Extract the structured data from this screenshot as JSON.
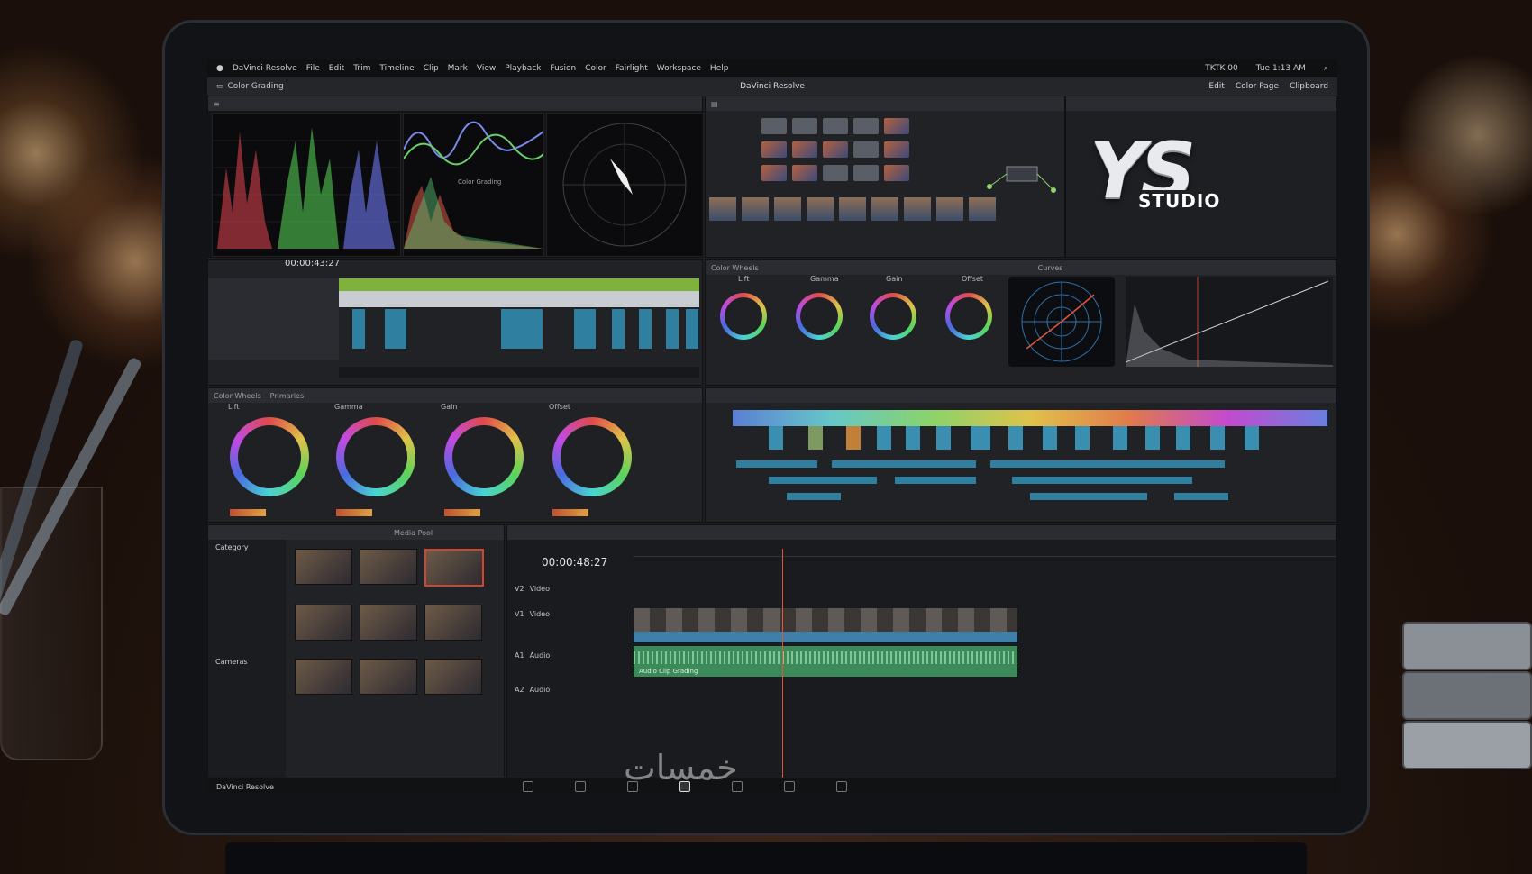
{
  "app": {
    "name": "DaVinci Resolve"
  },
  "menubar": {
    "apple": "",
    "app_title": "DaVinci Resolve",
    "items": [
      "File",
      "Edit",
      "Trim",
      "Timeline",
      "Clip",
      "Mark",
      "View",
      "Playback",
      "Fusion",
      "Color",
      "Fairlight",
      "Workspace",
      "Help"
    ],
    "right": [
      "TKTK 00",
      "Tue 1:13 AM"
    ]
  },
  "toolbar": {
    "color_grading": "Color Grading",
    "title": "DaVinci Resolve",
    "right": [
      "Edit",
      "Color Page",
      "Clipboard"
    ]
  },
  "scopes": {
    "wave_label": "Color Grading"
  },
  "timeline_top": {
    "timecode": "00:00:43:27"
  },
  "logo": {
    "ys": "YS",
    "studio": "STUDIO"
  },
  "color_panel": {
    "title": "Color Wheels",
    "curves": "Curves",
    "wheel_labels": [
      "Lift",
      "Gamma",
      "Gain",
      "Offset"
    ]
  },
  "wheels_panel": {
    "tabs": [
      "Color Wheels",
      "Primaries"
    ],
    "labels": [
      "Lift",
      "Gamma",
      "Gain",
      "Offset"
    ]
  },
  "media_pool": {
    "header": "Media Pool",
    "category": "Category",
    "cameras": "Cameras"
  },
  "timeline": {
    "timecode": "00:00:48:27",
    "tracks": [
      {
        "id": "V1",
        "name": "Video"
      },
      {
        "id": "V2",
        "name": "Video"
      },
      {
        "id": "A1",
        "name": "Audio"
      },
      {
        "id": "A2",
        "name": "Audio"
      }
    ],
    "audio_label": "Audio Clip Grading"
  },
  "bottom": {
    "brand": "DaVinci Resolve"
  },
  "watermark": {
    "text": "خمسات"
  },
  "colors": {
    "accent_red": "#d0452f",
    "clip_blue": "#2f7fa0",
    "audio_green": "#3c8a5a",
    "tl_green": "#7fb23a"
  }
}
